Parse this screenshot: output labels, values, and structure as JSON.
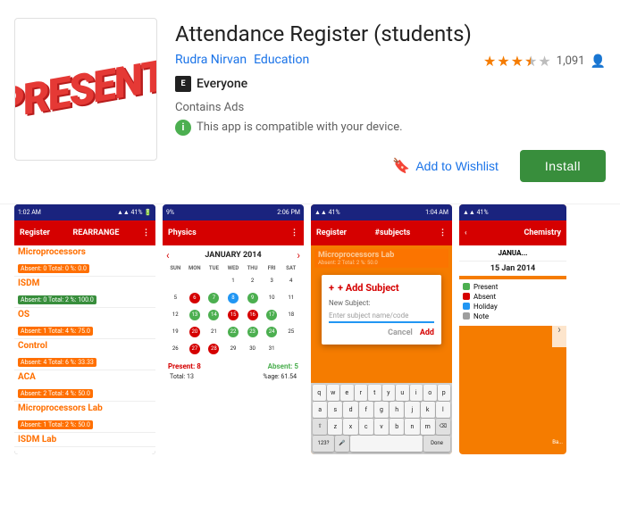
{
  "app": {
    "title": "Attendance Register (students)",
    "developer": "Rudra Nirvan",
    "category": "Education",
    "rating": 3.5,
    "rating_count": "1,091",
    "content_rating": "Everyone",
    "contains_ads": "Contains Ads",
    "compatible_text": "This app is compatible with your device.",
    "wishlist_label": "Add to Wishlist",
    "install_label": "Install",
    "icon_text_line1": "PRESENT!"
  },
  "stars": {
    "filled": 3,
    "half": 1,
    "empty": 1
  },
  "screenshots": [
    {
      "id": "ss1",
      "type": "attendance-list",
      "title": "Register",
      "subtitle": "REARRANGE",
      "time": "1:02 AM",
      "signal": "41%",
      "subjects": [
        {
          "name": "Microprocessors",
          "stats": "Absent: 0   Total: 0   %: 0.0",
          "color": "orange"
        },
        {
          "name": "ISDM",
          "stats": "Absent: 0   Total: 2   %: 100.0",
          "color": "green"
        },
        {
          "name": "OS",
          "stats": "Absent: 1   Total: 4   %: 75.0",
          "color": "orange"
        },
        {
          "name": "Control",
          "stats": "Absent: 4   Total: 6   %: 33.33",
          "color": "orange"
        },
        {
          "name": "ACA",
          "stats": "Absent: 2   Total: 4   %: 50.0",
          "color": "orange"
        },
        {
          "name": "Microprocessors Lab",
          "stats": "Absent: 1   Total: 2   %: 50.0",
          "color": "orange"
        },
        {
          "name": "ISDM Lab",
          "stats": "",
          "color": "orange"
        }
      ]
    },
    {
      "id": "ss2",
      "type": "calendar",
      "title": "Physics",
      "month": "JANUARY 2014",
      "days": [
        "SUN",
        "MON",
        "TUE",
        "WED",
        "THU",
        "FRI",
        "SAT"
      ],
      "present_count": "Present: 8",
      "absent_count": "Absent: 5",
      "total": "Total: 13",
      "percentage": "%age: 61.54"
    },
    {
      "id": "ss3",
      "type": "add-subject",
      "title": "Register",
      "subtitle": "#subjects",
      "add_subject_title": "+ Add Subject",
      "new_subject_label": "New Subject:",
      "input_placeholder": "Enter subject name/code",
      "cancel_label": "Cancel",
      "add_label": "Add"
    },
    {
      "id": "ss4",
      "type": "legend",
      "title": "Chemistry",
      "date_label": "15 Jan 2014",
      "legend_items": [
        "Present",
        "Absent",
        "Holiday",
        "Note"
      ]
    }
  ]
}
